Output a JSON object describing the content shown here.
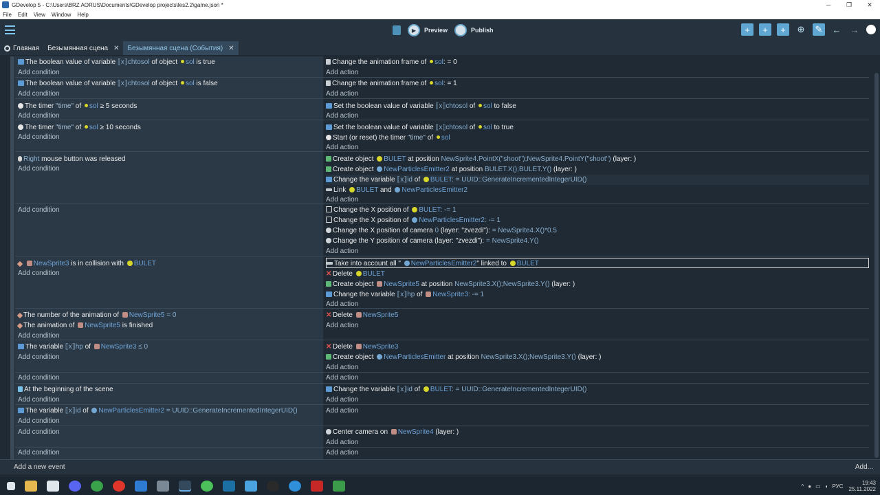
{
  "window": {
    "title": "GDevelop 5 - C:\\Users\\BRZ AORUS\\Documents\\GDevelop projects\\les2.2\\game.json *"
  },
  "menu": [
    "File",
    "Edit",
    "View",
    "Window",
    "Help"
  ],
  "toolbar": {
    "preview_label": "Preview",
    "publish_label": "Publish"
  },
  "tabs": [
    {
      "label": "Главная"
    },
    {
      "label": "Безымянная сцена"
    },
    {
      "label": "Безымянная сцена (События)"
    }
  ],
  "common": {
    "add_condition": "Add condition",
    "add_action": "Add action"
  },
  "events": {
    "e1": {
      "cond": [
        "The boolean value of variable",
        "chtosol",
        "of object",
        "sol",
        "is",
        "true"
      ],
      "act": [
        "Change the animation frame of",
        "sol",
        ": = 0"
      ]
    },
    "e2": {
      "cond": [
        "The boolean value of variable",
        "chtosol",
        "of object",
        "sol",
        "is",
        "false"
      ],
      "act": [
        "Change the animation frame of",
        "sol",
        ": = 1"
      ]
    },
    "e3": {
      "cond": [
        "The timer",
        "\"time\"",
        "of",
        "sol",
        "≥ 5",
        "seconds"
      ],
      "act": [
        "Set the boolean value of variable",
        "chtosol",
        "of",
        "sol",
        "to false"
      ]
    },
    "e4": {
      "cond": [
        "The timer",
        "\"time\"",
        "of",
        "sol",
        "≥ 10",
        "seconds"
      ],
      "act1": [
        "Set the boolean value of variable",
        "chtosol",
        "of",
        "sol",
        "to true"
      ],
      "act2": [
        "Start (or reset) the timer",
        "\"time\"",
        "of",
        "sol"
      ]
    },
    "e5": {
      "cond": [
        "Right",
        "mouse button was released"
      ],
      "act1": [
        "Create object",
        "BULET",
        "at position",
        "NewSprite4.PointX(\"shoot\");NewSprite4.PointY(\"shoot\")",
        "(layer: )"
      ],
      "act2": [
        "Create object",
        "NewParticlesEmitter2",
        "at position",
        "BULET.X();BULET.Y()",
        "(layer: )"
      ],
      "act3": [
        "Change the variable",
        "id",
        "of",
        "BULET",
        ": = UUID::GenerateIncrementedIntegerUID()"
      ],
      "act4": [
        "Link",
        "BULET",
        "and",
        "NewParticlesEmitter2"
      ]
    },
    "e6": {
      "act1": [
        "Change the X position of",
        "BULET",
        ": -= 1"
      ],
      "act2": [
        "Change the X position of",
        "NewParticlesEmitter2",
        ": -= 1"
      ],
      "act3": [
        "Change the X position of camera",
        "0",
        "(layer: \"zvezdi\"):",
        "= NewSprite4.X()*0.5"
      ],
      "act4": [
        "Change the Y position of camera",
        "(layer: \"zvezdi\"):",
        "= NewSprite4.Y()"
      ]
    },
    "e7": {
      "cond": [
        "NewSprite3",
        "is in collision with",
        "BULET"
      ],
      "act1": [
        "Take into account all \"",
        "NewParticlesEmitter2",
        "\" linked to",
        "BULET"
      ],
      "act2": [
        "Delete",
        "BULET"
      ],
      "act3": [
        "Create object",
        "NewSprite5",
        "at position",
        "NewSprite3.X();NewSprite3.Y()",
        "(layer: )"
      ],
      "act4": [
        "Change the variable",
        "hp",
        "of",
        "NewSprite3",
        ": -= 1"
      ]
    },
    "e8": {
      "cond1": [
        "The number of the animation of",
        "NewSprite5",
        "= 0"
      ],
      "cond2": [
        "The animation of",
        "NewSprite5",
        "is finished"
      ],
      "act": [
        "Delete",
        "NewSprite5"
      ]
    },
    "e9": {
      "cond": [
        "The variable",
        "hp",
        "of",
        "NewSprite3",
        "≤ 0"
      ],
      "act1": [
        "Delete",
        "NewSprite3"
      ],
      "act2": [
        "Create object",
        "NewParticlesEmitter",
        "at position",
        "NewSprite3.X();NewSprite3.Y()",
        "(layer: )"
      ]
    },
    "e11": {
      "cond": [
        "At the beginning of the scene"
      ],
      "act": [
        "Change the variable",
        "id",
        "of",
        "BULET",
        ": = UUID::GenerateIncrementedIntegerUID()"
      ]
    },
    "e12": {
      "cond": [
        "The variable",
        "id",
        "of",
        "NewParticlesEmitter2",
        "= UUID::GenerateIncrementedIntegerUID()"
      ]
    },
    "e13": {
      "act": [
        "Center camera on",
        "NewSprite4",
        "(layer: )"
      ]
    }
  },
  "bottom": {
    "add_event": "Add a new event",
    "add_more": "Add..."
  },
  "tray": {
    "lang": "РУС",
    "time": "19:43",
    "date": "25.11.2022"
  }
}
